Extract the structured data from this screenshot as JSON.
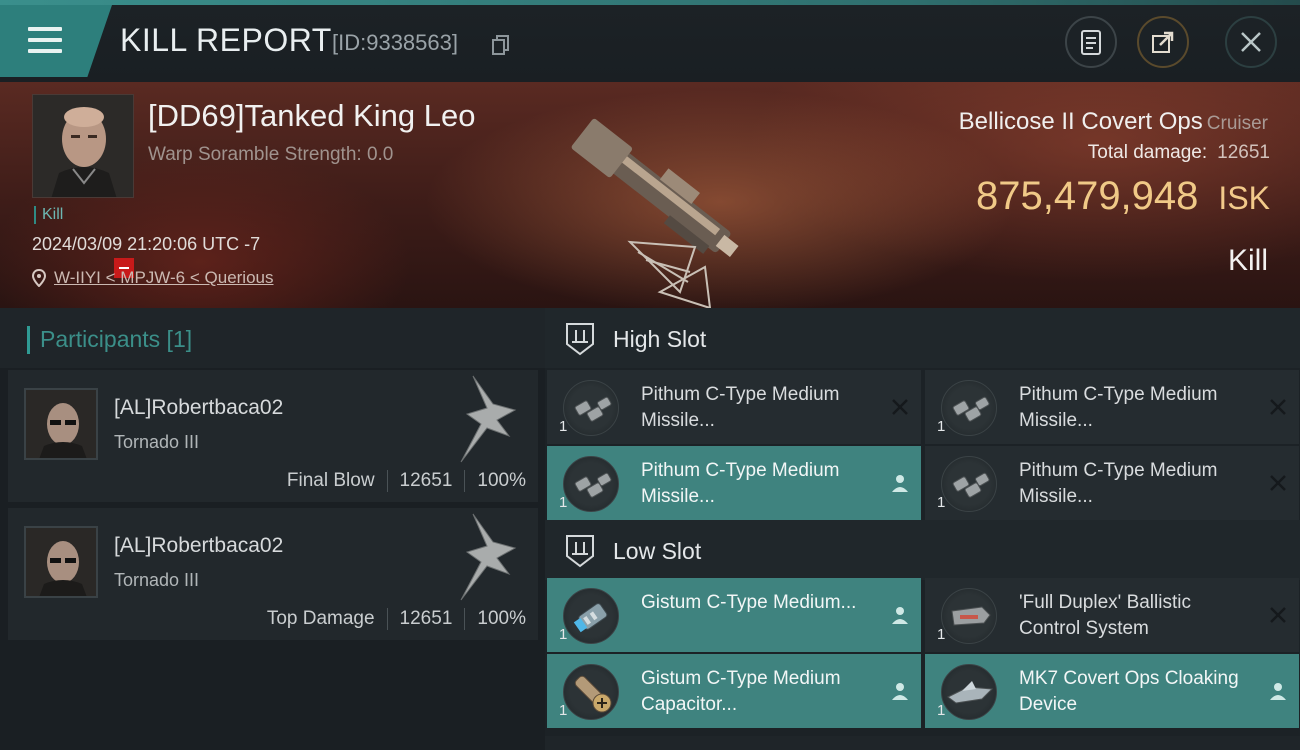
{
  "header": {
    "title": "KILL REPORT",
    "kill_id": "[ID:9338563]",
    "buttons": [
      "clipboard",
      "share",
      "close"
    ]
  },
  "victim": {
    "name": "[DD69]Tanked King Leo",
    "warp_scramble": "Warp Soramble Strength: 0.0",
    "tag": "Kill",
    "timestamp": "2024/03/09 21:20:06 UTC -7",
    "location": "W-IIYI < MPJW-6 < Querious",
    "ship_name": "Bellicose II Covert Ops",
    "ship_class": "Cruiser",
    "total_damage_label": "Total damage:",
    "total_damage": "12651",
    "isk_value": "875,479,948",
    "isk_unit": "ISK",
    "result": "Kill"
  },
  "participants": {
    "title": "Participants [1]",
    "items": [
      {
        "name": "[AL]Robertbaca02",
        "ship": "Tornado III",
        "role": "Final Blow",
        "damage": "12651",
        "percent": "100%"
      },
      {
        "name": "[AL]Robertbaca02",
        "ship": "Tornado III",
        "role": "Top Damage",
        "damage": "12651",
        "percent": "100%"
      }
    ]
  },
  "slots": {
    "high": {
      "title": "High Slot",
      "modules": [
        {
          "name": "Pithum C-Type Medium Missile...",
          "qty": "1",
          "state": "destroyed"
        },
        {
          "name": "Pithum C-Type Medium Missile...",
          "qty": "1",
          "state": "destroyed"
        },
        {
          "name": "Pithum C-Type Medium Missile...",
          "qty": "1",
          "state": "dropped"
        },
        {
          "name": "Pithum C-Type Medium Missile...",
          "qty": "1",
          "state": "destroyed"
        }
      ]
    },
    "low": {
      "title": "Low Slot",
      "modules": [
        {
          "name": "Gistum C-Type Medium...",
          "qty": "1",
          "state": "dropped"
        },
        {
          "name": "'Full Duplex' Ballistic Control System",
          "qty": "1",
          "state": "destroyed"
        },
        {
          "name": "Gistum C-Type Medium Capacitor...",
          "qty": "1",
          "state": "dropped"
        },
        {
          "name": "MK7 Covert Ops Cloaking Device",
          "qty": "1",
          "state": "dropped"
        }
      ]
    }
  },
  "colors": {
    "accent": "#3f837f",
    "isk": "#f0c987",
    "kill_badge": "#c81a1a"
  }
}
